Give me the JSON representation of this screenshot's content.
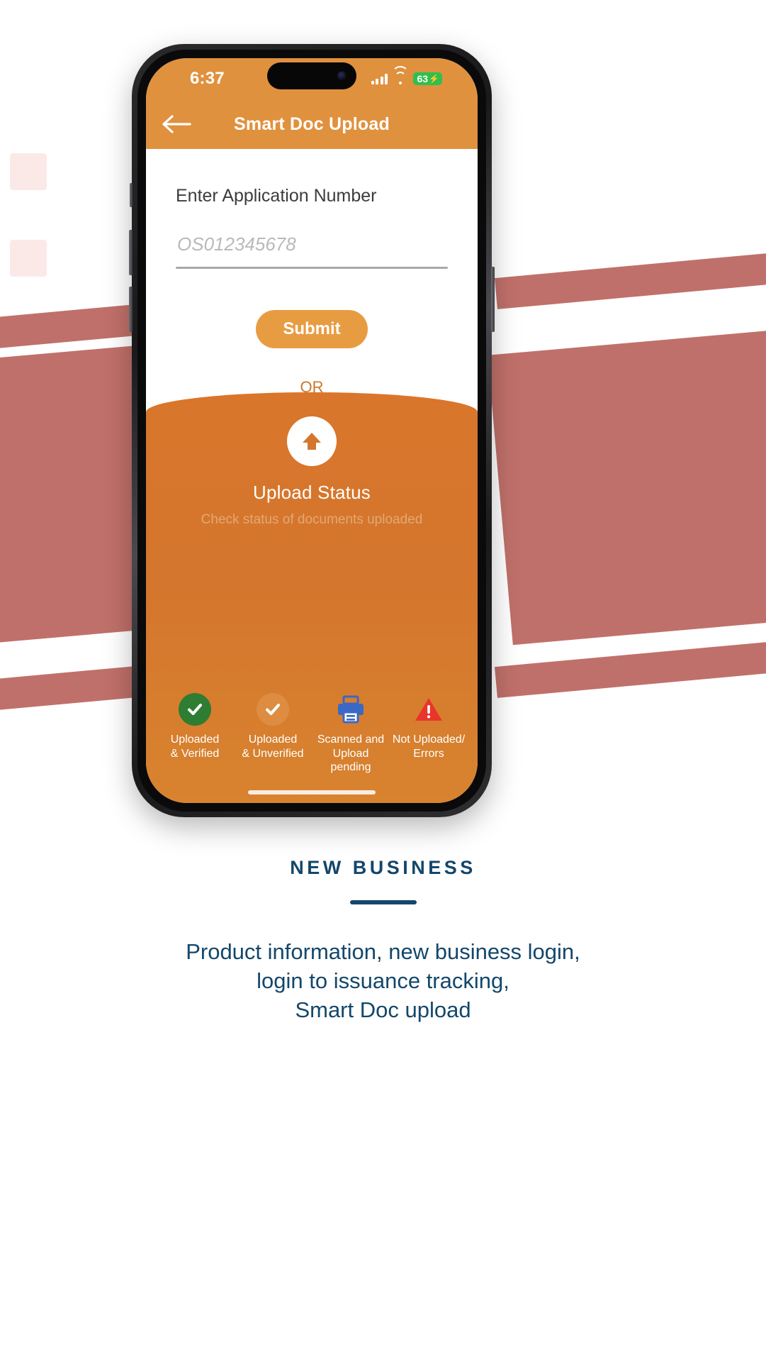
{
  "phone": {
    "status_bar": {
      "time": "6:37",
      "battery_percent": "63",
      "charging_glyph": "⚡",
      "signal_icon": "cellular-signal-icon",
      "wifi_icon": "wifi-icon"
    },
    "app_bar": {
      "title": "Smart Doc Upload",
      "back_icon": "back-arrow-icon"
    },
    "form": {
      "label": "Enter Application Number",
      "input_value": "",
      "input_placeholder": "OS012345678",
      "submit_label": "Submit",
      "divider_text": "OR"
    },
    "status_panel": {
      "upload_icon": "upload-arrow-icon",
      "title": "Upload Status",
      "subtitle": "Check status of documents uploaded",
      "legend": [
        {
          "icon": "check-circle-green-icon",
          "label": "Uploaded\n& Verified"
        },
        {
          "icon": "check-circle-orange-icon",
          "label": "Uploaded\n& Unverified"
        },
        {
          "icon": "printer-icon",
          "label": "Scanned and\nUpload\npending"
        },
        {
          "icon": "warning-triangle-icon",
          "label": "Not Uploaded/\nErrors"
        }
      ]
    }
  },
  "caption": {
    "kicker": "NEW BUSINESS",
    "lines": [
      "Product information, new business login,",
      "login to issuance tracking,",
      "Smart Doc upload"
    ]
  },
  "colors": {
    "header_orange": "#E0913E",
    "panel_orange": "#D4762D",
    "submit_orange": "#E89C42",
    "or_text": "#C9782A",
    "caption_blue": "#13476B",
    "battery_green": "#2FBF4F",
    "verified_green": "#2E7D32",
    "printer_blue": "#3B68C4",
    "error_red": "#E8352B",
    "deco_pink": "#FBE9E8",
    "deco_band": "#C0706A"
  }
}
